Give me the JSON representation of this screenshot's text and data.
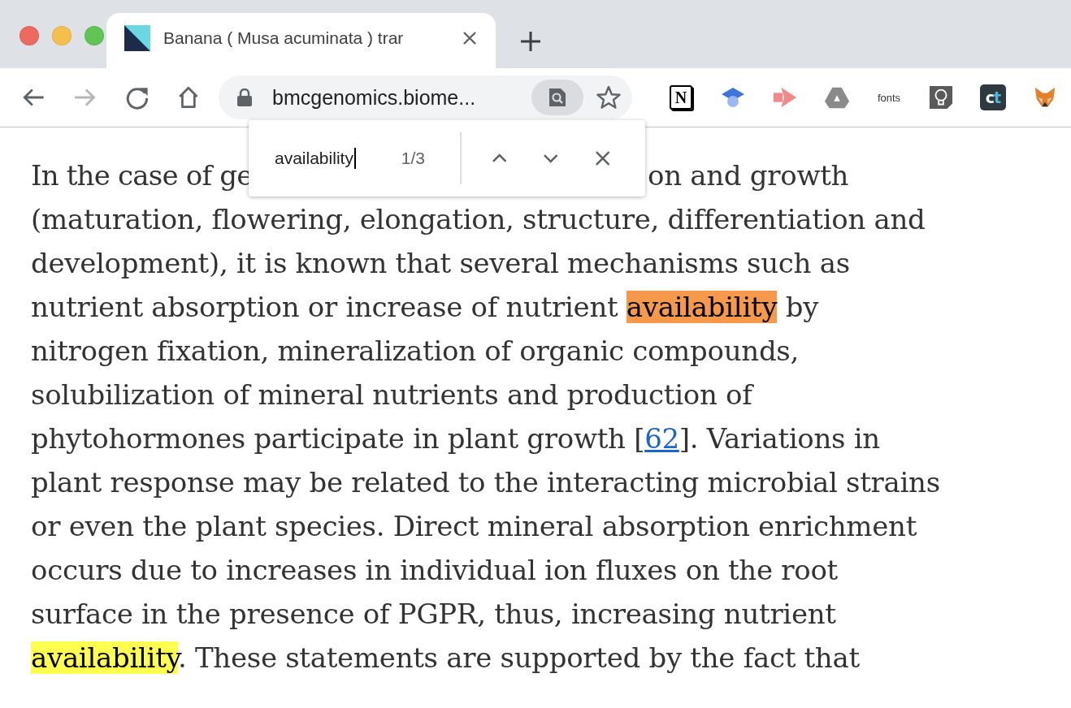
{
  "window": {
    "controls": [
      {
        "color": "#ed6a5e"
      },
      {
        "color": "#f5bf4f"
      },
      {
        "color": "#61c554"
      }
    ]
  },
  "tabs": [
    {
      "title": "Banana ( Musa acuminata ) trar",
      "selected": true
    }
  ],
  "toolbar": {
    "nav_buttons": [
      {
        "kind": "back",
        "disabled": false
      },
      {
        "kind": "forward",
        "disabled": true
      },
      {
        "kind": "reload",
        "disabled": false
      },
      {
        "kind": "home",
        "disabled": false
      }
    ],
    "address": {
      "url": "bmcgenomics.biome..."
    },
    "extensions": [
      {
        "kind": "letter_cube",
        "label": "N"
      },
      {
        "kind": "cap"
      },
      {
        "kind": "arrow"
      },
      {
        "kind": "triangle"
      },
      {
        "kind": "text",
        "label": "fonts"
      },
      {
        "kind": "bulb"
      },
      {
        "kind": "letter_tile",
        "label": "c",
        "accent": "t"
      },
      {
        "kind": "fox"
      }
    ]
  },
  "find_bar": {
    "query": "availability",
    "count": "1/3"
  },
  "article": {
    "first_line": [
      "In the case of ge",
      "on and growth"
    ],
    "segments": [
      {
        "kind": "plain",
        "text": "(maturation, flowering, elongation, structure, differentiation and\ndevelopment), it is known that several mechanisms such as\nnutrient absorption or increase of nutrient "
      },
      {
        "kind": "match",
        "text": "availability",
        "current": true
      },
      {
        "kind": "plain",
        "text": " by\nnitrogen fixation, mineralization of organic compounds,\nsolubilization of mineral nutrients and production of\nphytohormones participate in plant growth ["
      },
      {
        "kind": "link",
        "text": "62"
      },
      {
        "kind": "plain",
        "text": "]. Variations in\nplant response may be related to the interacting microbial strains\nor even the plant species. Direct mineral absorption enrichment\noccurs due to increases in individual ion fluxes on the root\nsurface in the presence of PGPR, thus, increasing nutrient\n"
      },
      {
        "kind": "match",
        "text": "availability",
        "current": false
      },
      {
        "kind": "plain",
        "text": ". These statements are supported by the fact that"
      }
    ]
  }
}
